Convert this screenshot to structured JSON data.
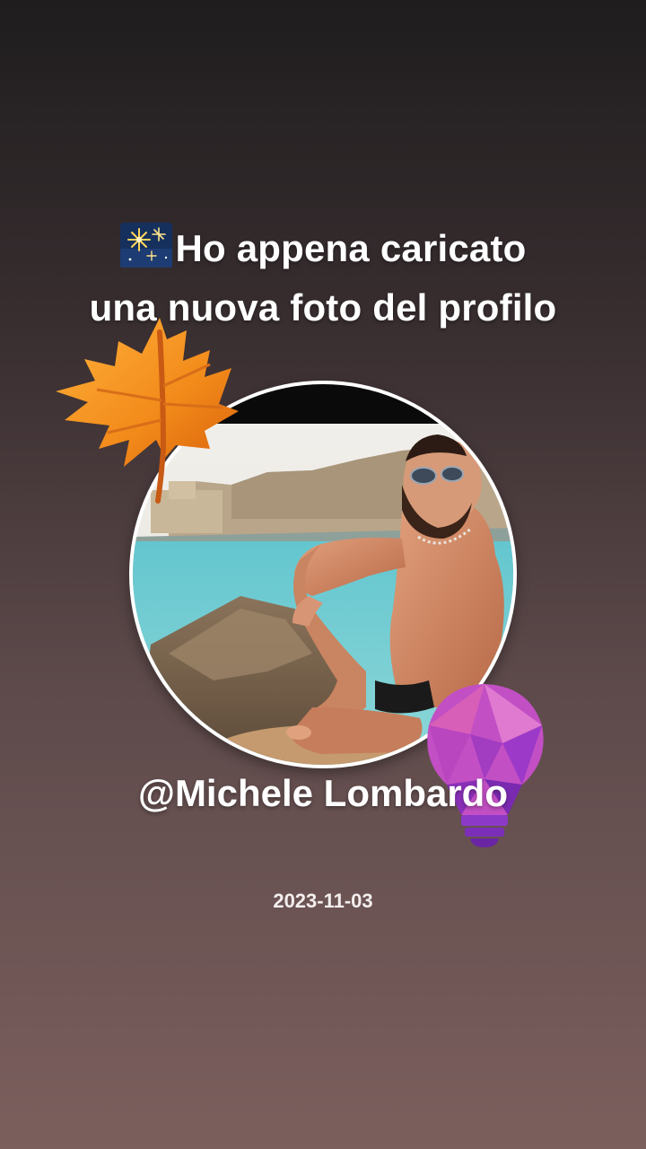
{
  "post": {
    "headline_line1": "Ho appena caricato",
    "headline_line2": "una nuova foto del profilo",
    "username": "@Michele Lombardo",
    "date": "2023-11-03"
  },
  "stickers": {
    "headline_emoji": "fireworks-icon",
    "left_sticker": "maple-leaf-icon",
    "right_sticker": "lightbulb-icon"
  },
  "colors": {
    "background_top": "#1f1d1e",
    "background_bottom": "#7b5f5d",
    "text": "#ffffff",
    "avatar_border": "#ffffff",
    "leaf": "#f08a1c",
    "bulb": "#b04fd0"
  }
}
